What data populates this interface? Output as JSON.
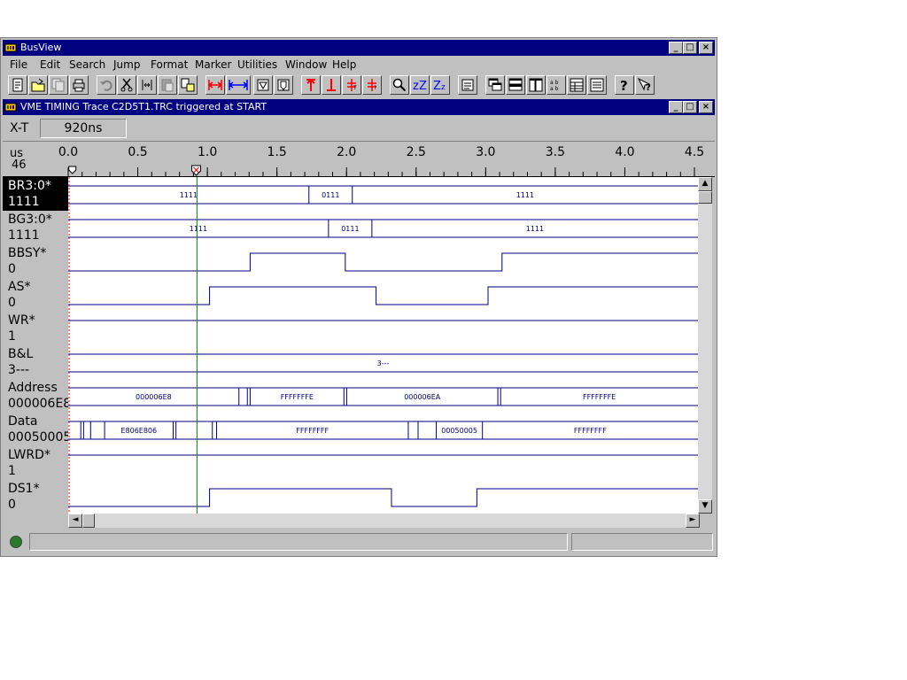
{
  "app": {
    "title": "BusView"
  },
  "menu": {
    "items": [
      "File",
      "Edit",
      "Search",
      "Jump",
      "Format",
      "Marker",
      "Utilities",
      "Window",
      "Help"
    ]
  },
  "toolbar": {
    "icons": [
      "new-icon",
      "open-icon",
      "copy-icon",
      "print-icon",
      "undo-icon",
      "cut-icon",
      "fit-icon",
      "paste-icon",
      "find-icon",
      "range-icon",
      "marker-down-icon",
      "marker-tag-icon",
      "arrow-up-red-icon",
      "arrow-down-red-icon",
      "cursor-t-icon",
      "cursor-q-icon",
      "zoom-icon",
      "zoom-in-icon",
      "zoom-out-icon",
      "pdf-icon",
      "cascade-icon",
      "tile-horizontal-icon",
      "tile-vertical-icon",
      "arrange-icon",
      "table-icon",
      "settings-icon",
      "help-icon",
      "context-help-icon"
    ]
  },
  "child_window": {
    "title": "VME TIMING Trace C2D5T1.TRC triggered at START"
  },
  "xt": {
    "label": "X-T",
    "value": "920ns"
  },
  "ruler": {
    "unit": "us",
    "position": "46",
    "ticks": [
      "0.0",
      "0.5",
      "1.0",
      "1.5",
      "2.0",
      "2.5",
      "3.0",
      "3.5",
      "4.0",
      "4.5"
    ],
    "range_us": [
      0,
      4.5
    ]
  },
  "cursor_time_us": 0.92,
  "signals": [
    {
      "name": "BR3:0*",
      "value": "1111",
      "selected": true,
      "type": "bus",
      "segments": [
        {
          "from": 0.0,
          "to": 1.72,
          "label": "1111"
        },
        {
          "from": 1.72,
          "to": 2.03,
          "label": "0111"
        },
        {
          "from": 2.03,
          "to": 4.5,
          "label": "1111"
        }
      ]
    },
    {
      "name": "BG3:0*",
      "value": "1111",
      "selected": false,
      "type": "bus",
      "segments": [
        {
          "from": 0.0,
          "to": 1.86,
          "label": "1111"
        },
        {
          "from": 1.86,
          "to": 2.17,
          "label": "0111"
        },
        {
          "from": 2.17,
          "to": 4.5,
          "label": "1111"
        }
      ]
    },
    {
      "name": "BBSY*",
      "value": "0",
      "selected": false,
      "type": "digital",
      "edges": [
        {
          "t": 0.0,
          "level": 0
        },
        {
          "t": 1.3,
          "level": 1
        },
        {
          "t": 1.98,
          "level": 0
        },
        {
          "t": 3.1,
          "level": 1
        }
      ]
    },
    {
      "name": "AS*",
      "value": "0",
      "selected": false,
      "type": "digital",
      "edges": [
        {
          "t": 0.0,
          "level": 0
        },
        {
          "t": 1.01,
          "level": 1
        },
        {
          "t": 2.2,
          "level": 0
        },
        {
          "t": 3.0,
          "level": 1
        }
      ]
    },
    {
      "name": "WR*",
      "value": "1",
      "selected": false,
      "type": "digital",
      "edges": [
        {
          "t": 0.0,
          "level": 1
        }
      ]
    },
    {
      "name": "B&L",
      "value": "3---",
      "selected": false,
      "type": "bus",
      "segments": [
        {
          "from": 0.0,
          "to": 4.5,
          "label": "3---"
        }
      ]
    },
    {
      "name": "Address",
      "value": "000006E8",
      "selected": false,
      "type": "bus",
      "segments": [
        {
          "from": 0.0,
          "to": 1.22,
          "label": "000006E8"
        },
        {
          "from": 1.22,
          "to": 1.28,
          "label": ""
        },
        {
          "from": 1.28,
          "to": 1.3,
          "label": ""
        },
        {
          "from": 1.3,
          "to": 1.97,
          "label": "FFFFFFFE"
        },
        {
          "from": 1.97,
          "to": 1.99,
          "label": ""
        },
        {
          "from": 1.99,
          "to": 3.07,
          "label": "000006EA"
        },
        {
          "from": 3.07,
          "to": 3.09,
          "label": ""
        },
        {
          "from": 3.09,
          "to": 4.5,
          "label": "FFFFFFFE"
        }
      ]
    },
    {
      "name": "Data",
      "value": "00050005",
      "selected": false,
      "type": "bus",
      "segments": [
        {
          "from": 0.0,
          "to": 0.09,
          "label": ""
        },
        {
          "from": 0.09,
          "to": 0.11,
          "label": ""
        },
        {
          "from": 0.11,
          "to": 0.16,
          "label": ""
        },
        {
          "from": 0.16,
          "to": 0.26,
          "label": ""
        },
        {
          "from": 0.26,
          "to": 0.75,
          "label": "E806E806"
        },
        {
          "from": 0.75,
          "to": 0.77,
          "label": ""
        },
        {
          "from": 0.77,
          "to": 1.03,
          "label": ""
        },
        {
          "from": 1.03,
          "to": 1.06,
          "label": ""
        },
        {
          "from": 1.06,
          "to": 2.43,
          "label": "FFFFFFFF"
        },
        {
          "from": 2.43,
          "to": 2.5,
          "label": ""
        },
        {
          "from": 2.5,
          "to": 2.63,
          "label": ""
        },
        {
          "from": 2.63,
          "to": 2.96,
          "label": "00050005"
        },
        {
          "from": 2.96,
          "to": 4.5,
          "label": "FFFFFFFF"
        }
      ]
    },
    {
      "name": "LWRD*",
      "value": "1",
      "selected": false,
      "type": "digital",
      "edges": [
        {
          "t": 0.0,
          "level": 1
        }
      ]
    },
    {
      "name": "DS1*",
      "value": "0",
      "selected": false,
      "type": "digital",
      "edges": [
        {
          "t": 0.0,
          "level": 0
        },
        {
          "t": 1.01,
          "level": 1
        },
        {
          "t": 2.31,
          "level": 0
        },
        {
          "t": 2.92,
          "level": 1
        }
      ]
    }
  ],
  "colors": {
    "titlebar": "#000080",
    "cursor_line": "#008000",
    "wave_line": "#000080",
    "ruler_marker_red": "#ff0000"
  }
}
